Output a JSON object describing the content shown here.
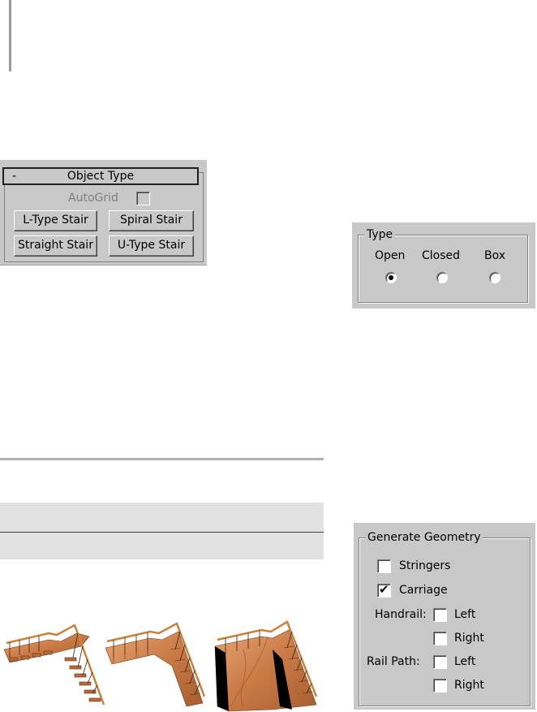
{
  "object_type": {
    "collapse_symbol": "-",
    "title": "Object Type",
    "autogrid_label": "AutoGrid",
    "autogrid_checked": false,
    "buttons": [
      "L-Type Stair",
      "Spiral Stair",
      "Straight Stair",
      "U-Type Stair"
    ]
  },
  "type_group": {
    "title": "Type",
    "options": [
      "Open",
      "Closed",
      "Box"
    ],
    "selected": "Open"
  },
  "generate_geometry": {
    "title": "Generate Geometry",
    "stringers_label": "Stringers",
    "stringers_checked": false,
    "carriage_label": "Carriage",
    "carriage_checked": true,
    "handrail_label": "Handrail:",
    "rail_path_label": "Rail Path:",
    "left_label": "Left",
    "right_label": "Right"
  },
  "illustration": {
    "stair_variants": [
      "open",
      "closed",
      "box"
    ],
    "colors": {
      "wood": "#d4895a",
      "wood_dark": "#8a4a22",
      "rail": "#5a3a20",
      "side": "#000000"
    }
  },
  "colors": {
    "panel_bg": "#c8c8c8",
    "doc_band": "#e0e0e0",
    "rule": "#b0b0b0"
  }
}
